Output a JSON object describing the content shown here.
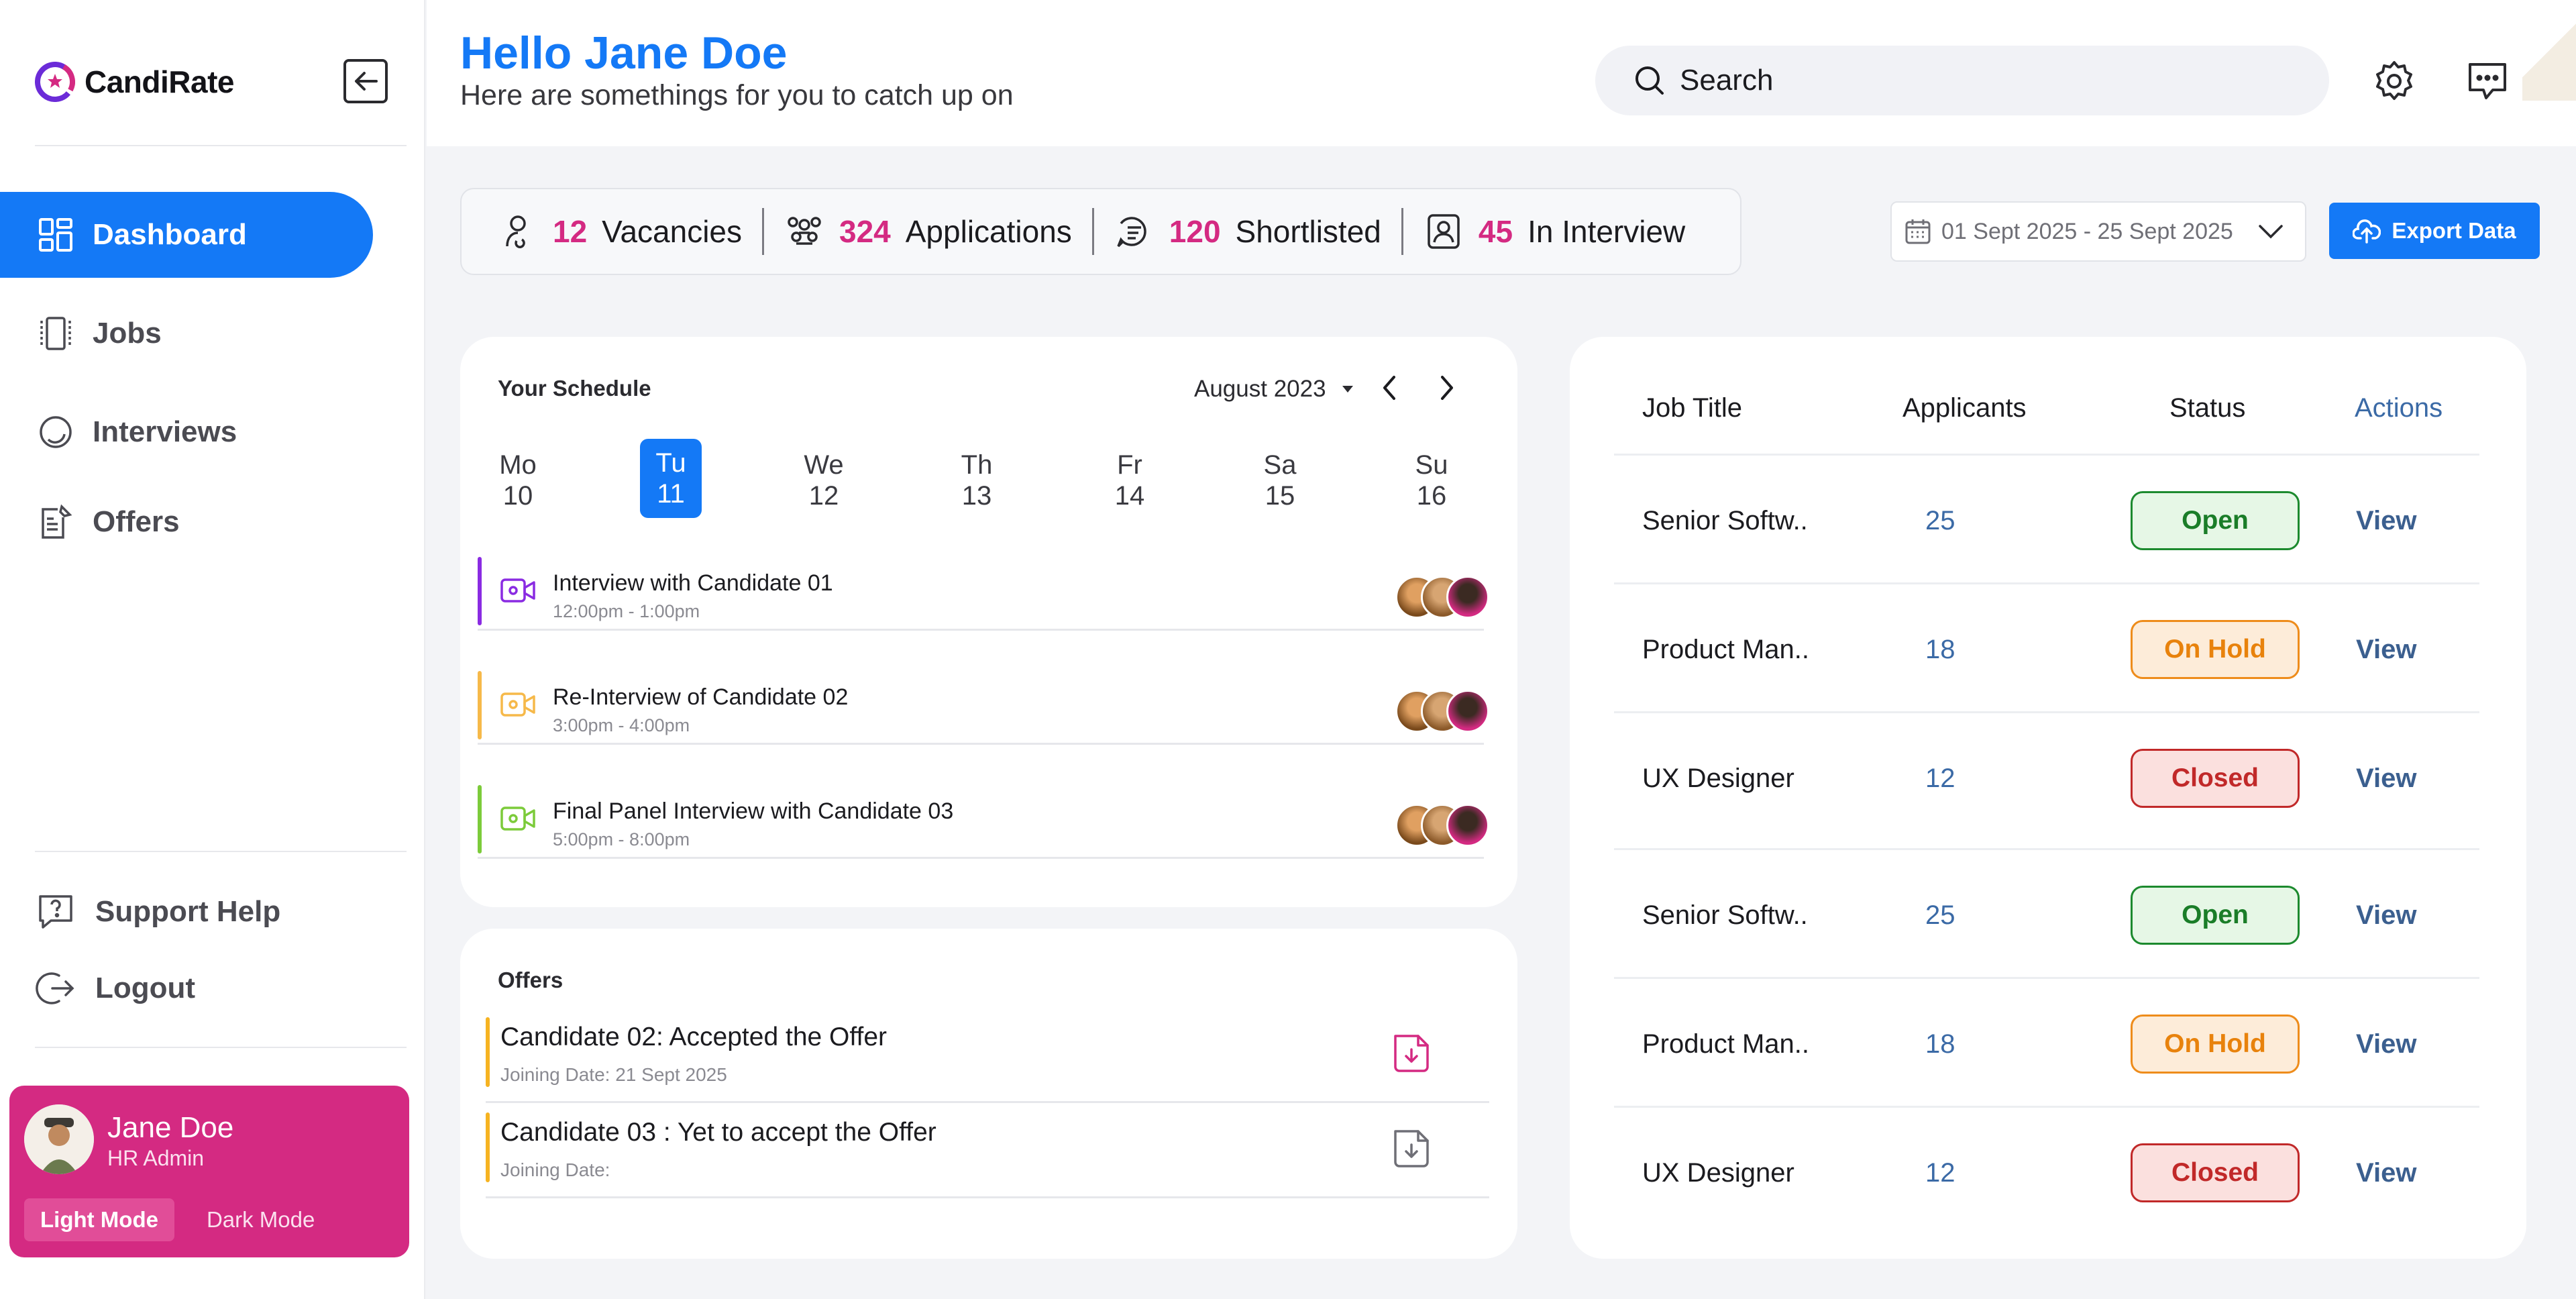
{
  "app": {
    "name": "CandiRate"
  },
  "sidebar": {
    "nav": [
      {
        "label": "Dashboard",
        "icon": "dashboard-icon",
        "active": true
      },
      {
        "label": "Jobs",
        "icon": "jobs-icon",
        "active": false
      },
      {
        "label": "Interviews",
        "icon": "interviews-icon",
        "active": false
      },
      {
        "label": "Offers",
        "icon": "offers-icon",
        "active": false
      }
    ],
    "support_label": "Support Help",
    "logout_label": "Logout",
    "profile": {
      "name": "Jane Doe",
      "role": "HR Admin",
      "light_mode": "Light Mode",
      "dark_mode": "Dark Mode"
    }
  },
  "header": {
    "greeting": "Hello Jane Doe",
    "subtitle": "Here are somethings for you to catch up on",
    "search_placeholder": "Search"
  },
  "stats": [
    {
      "value": "12",
      "label": "Vacancies"
    },
    {
      "value": "324",
      "label": "Applications"
    },
    {
      "value": "120",
      "label": "Shortlisted"
    },
    {
      "value": "45",
      "label": "In Interview"
    }
  ],
  "date_range": "01 Sept 2025 - 25 Sept 2025",
  "export_label": "Export Data",
  "schedule": {
    "title": "Your Schedule",
    "month": "August 2023",
    "days": [
      {
        "name": "Mo",
        "num": "10"
      },
      {
        "name": "Tu",
        "num": "11"
      },
      {
        "name": "We",
        "num": "12"
      },
      {
        "name": "Th",
        "num": "13"
      },
      {
        "name": "Fr",
        "num": "14"
      },
      {
        "name": "Sa",
        "num": "15"
      },
      {
        "name": "Su",
        "num": "16"
      }
    ],
    "events": [
      {
        "title": "Interview with Candidate 01",
        "time": "12:00pm - 1:00pm",
        "color": "#8a2be2"
      },
      {
        "title": "Re-Interview of Candidate 02",
        "time": "3:00pm - 4:00pm",
        "color": "#f6b94a"
      },
      {
        "title": "Final Panel Interview with Candidate 03",
        "time": "5:00pm - 8:00pm",
        "color": "#7ccb3a"
      }
    ]
  },
  "offers": {
    "title": "Offers",
    "items": [
      {
        "title": "Candidate 02: Accepted the Offer",
        "date": "Joining Date: 21 Sept 2025"
      },
      {
        "title": "Candidate 03 : Yet to accept the Offer",
        "date": "Joining Date:"
      }
    ]
  },
  "jobs_table": {
    "headers": {
      "title": "Job Title",
      "applicants": "Applicants",
      "status": "Status",
      "actions": "Actions"
    },
    "rows": [
      {
        "title": "Senior Softw..",
        "applicants": "25",
        "status": "Open",
        "action": "View"
      },
      {
        "title": "Product Man..",
        "applicants": "18",
        "status": "On Hold",
        "action": "View"
      },
      {
        "title": "UX Designer",
        "applicants": "12",
        "status": "Closed",
        "action": "View"
      },
      {
        "title": "Senior Softw..",
        "applicants": "25",
        "status": "Open",
        "action": "View"
      },
      {
        "title": "Product Man..",
        "applicants": "18",
        "status": "On Hold",
        "action": "View"
      },
      {
        "title": "UX Designer",
        "applicants": "12",
        "status": "Closed",
        "action": "View"
      }
    ]
  },
  "colors": {
    "brand": "#1479f6",
    "accent": "#d42a82"
  }
}
